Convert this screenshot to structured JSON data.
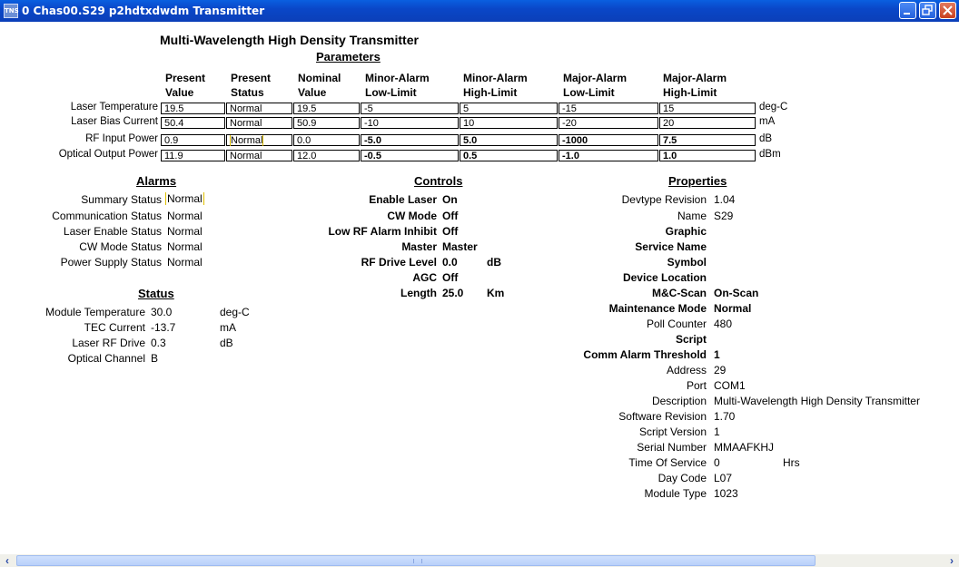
{
  "window": {
    "title": "0 Chas00.S29 p2hdtxdwdm Transmitter",
    "icon_text": "TNS"
  },
  "main_title": "Multi-Wavelength High Density Transmitter",
  "parameters": {
    "header": "Parameters",
    "columns": [
      [
        "Present",
        "Value"
      ],
      [
        "Present",
        "Status"
      ],
      [
        "Nominal",
        "Value"
      ],
      [
        "Minor-Alarm",
        "Low-Limit"
      ],
      [
        "Minor-Alarm",
        "High-Limit"
      ],
      [
        "Major-Alarm",
        "Low-Limit"
      ],
      [
        "Major-Alarm",
        "High-Limit"
      ]
    ],
    "rows": [
      {
        "label": "Laser Temperature",
        "present": "19.5",
        "status": "Normal",
        "nominal": "19.5",
        "minor_low": "-5",
        "minor_high": "5",
        "major_low": "-15",
        "major_high": "15",
        "unit": "deg-C"
      },
      {
        "label": "Laser Bias Current",
        "present": "50.4",
        "status": "Normal",
        "nominal": "50.9",
        "minor_low": "-10",
        "minor_high": "10",
        "major_low": "-20",
        "major_high": "20",
        "unit": "mA"
      },
      {
        "label": "RF Input Power",
        "present": "0.9",
        "status": "Normal",
        "nominal": "0.0",
        "minor_low": "-5.0",
        "minor_high": "5.0",
        "major_low": "-1000",
        "major_high": "7.5",
        "unit": "dB"
      },
      {
        "label": "Optical Output Power",
        "present": "11.9",
        "status": "Normal",
        "nominal": "12.0",
        "minor_low": "-0.5",
        "minor_high": "0.5",
        "major_low": "-1.0",
        "major_high": "1.0",
        "unit": "dBm"
      }
    ]
  },
  "alarms": {
    "header": "Alarms",
    "items": [
      {
        "label": "Summary Status",
        "value": "Normal"
      },
      {
        "label": "Communication Status",
        "value": "Normal"
      },
      {
        "label": "Laser Enable Status",
        "value": "Normal"
      },
      {
        "label": "CW Mode Status",
        "value": "Normal"
      },
      {
        "label": "Power Supply Status",
        "value": "Normal"
      }
    ]
  },
  "status": {
    "header": "Status",
    "items": [
      {
        "label": "Module Temperature",
        "value": "30.0",
        "unit": "deg-C"
      },
      {
        "label": "TEC Current",
        "value": "-13.7",
        "unit": "mA"
      },
      {
        "label": "Laser RF Drive",
        "value": "0.3",
        "unit": "dB"
      },
      {
        "label": "Optical Channel",
        "value": "B",
        "unit": ""
      }
    ]
  },
  "controls": {
    "header": "Controls",
    "items": [
      {
        "label": "Enable Laser",
        "value": "On",
        "unit": ""
      },
      {
        "label": "CW Mode",
        "value": "Off",
        "unit": ""
      },
      {
        "label": "Low RF Alarm Inhibit",
        "value": "Off",
        "unit": ""
      },
      {
        "label": "Master",
        "value": "Master",
        "unit": ""
      },
      {
        "label": "RF Drive Level",
        "value": "0.0",
        "unit": "dB"
      },
      {
        "label": "AGC",
        "value": "Off",
        "unit": ""
      },
      {
        "label": "Length",
        "value": "25.0",
        "unit": "Km"
      }
    ]
  },
  "properties": {
    "header": "Properties",
    "items": [
      {
        "label": "Devtype Revision",
        "value": "1.04",
        "unit": ""
      },
      {
        "label": "Name",
        "value": "S29",
        "unit": ""
      },
      {
        "label": "Graphic",
        "value": "",
        "unit": ""
      },
      {
        "label": "Service Name",
        "value": "",
        "unit": ""
      },
      {
        "label": "Symbol",
        "value": "",
        "unit": ""
      },
      {
        "label": "Device Location",
        "value": "",
        "unit": ""
      },
      {
        "label": "M&C-Scan",
        "value": "On-Scan",
        "unit": ""
      },
      {
        "label": "Maintenance Mode",
        "value": "Normal",
        "unit": ""
      },
      {
        "label": "Poll Counter",
        "value": "480",
        "unit": ""
      },
      {
        "label": "Script",
        "value": "",
        "unit": ""
      },
      {
        "label": "Comm Alarm Threshold",
        "value": "1",
        "unit": ""
      },
      {
        "label": "Address",
        "value": "29",
        "unit": ""
      },
      {
        "label": "Port",
        "value": "COM1",
        "unit": ""
      },
      {
        "label": "Description",
        "value": "Multi-Wavelength High Density Transmitter",
        "unit": ""
      },
      {
        "label": "Software Revision",
        "value": "1.70",
        "unit": ""
      },
      {
        "label": "Script Version",
        "value": "1",
        "unit": ""
      },
      {
        "label": "Serial Number",
        "value": "MMAAFKHJ",
        "unit": ""
      },
      {
        "label": "Time Of Service",
        "value": "0",
        "unit": "Hrs"
      },
      {
        "label": "Day Code",
        "value": "L07",
        "unit": ""
      },
      {
        "label": "Module Type",
        "value": "1023",
        "unit": ""
      }
    ]
  },
  "colors": {
    "titlebar": "#0a47c8",
    "highlight": "#e0c000"
  }
}
